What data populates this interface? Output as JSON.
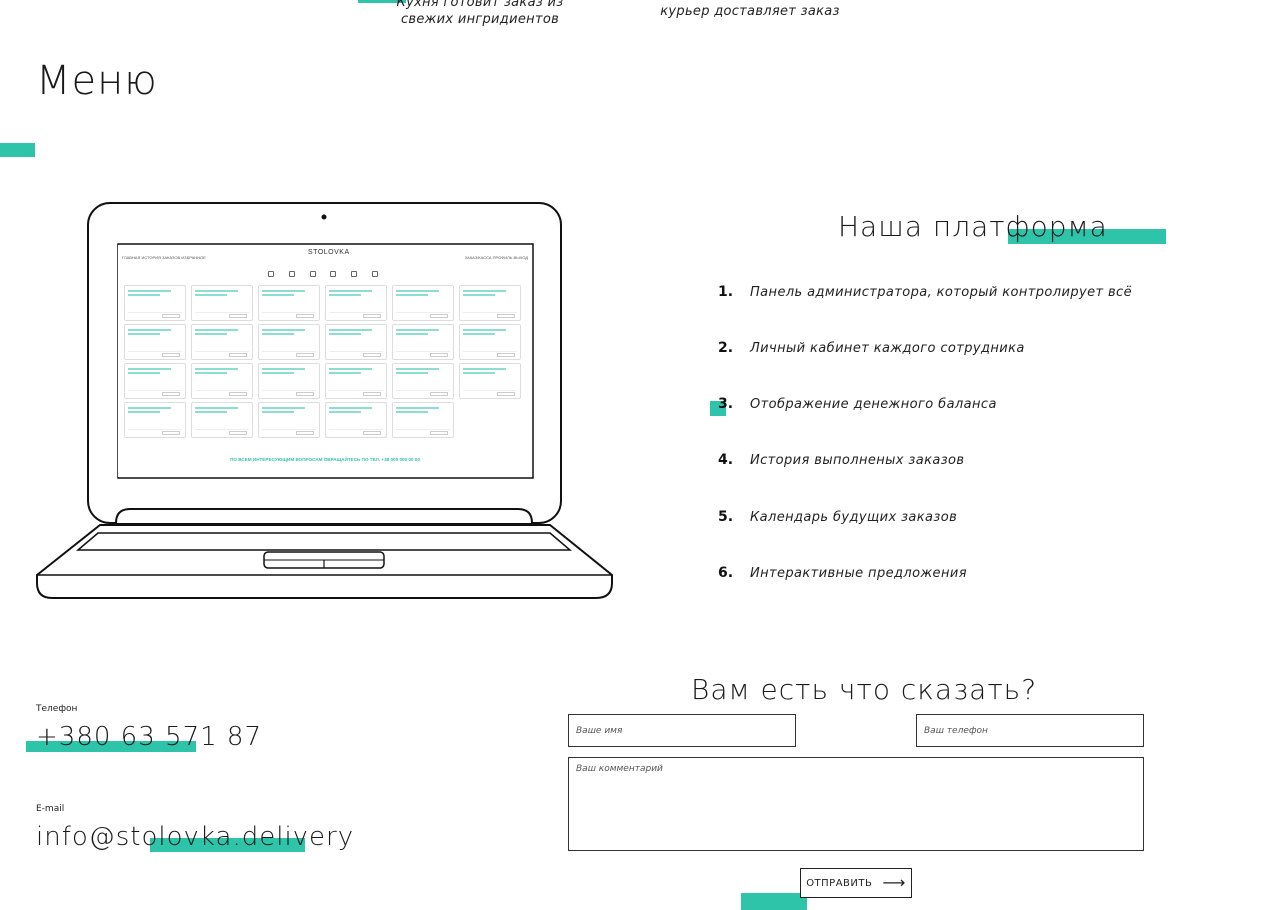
{
  "steps": {
    "kitchen": "Кухня готовит заказ из свежих ингридиентов",
    "courier": "курьер доставляет заказ"
  },
  "menu": {
    "title": "Меню"
  },
  "laptop_screen": {
    "nav_left": "ГЛАВНАЯ   ИСТОРИЯ ЗАКАЗОВ   ИЗБРАННОЕ",
    "nav_right": "ЗАКАЗ/КАССА   ПРОФИЛЬ   ВЫХОД",
    "logo": "STOLOVKA",
    "footer": "ПО ВСЕМ ИНТЕРЕСУЮЩИМ ВОПРОСАМ ОБРАЩАЙТЕСЬ ПО ТЕЛ. +38 000 000 00 00"
  },
  "platform": {
    "title": "Наша платформа",
    "items": [
      {
        "num": "1.",
        "text": "Панель администратора, который контролирует всё"
      },
      {
        "num": "2.",
        "text": "Личный кабинет каждого сотрудника"
      },
      {
        "num": "3.",
        "text": "Отображение денежного баланса"
      },
      {
        "num": "4.",
        "text": "История выполненых заказов"
      },
      {
        "num": "5.",
        "text": "Календарь будущих заказов"
      },
      {
        "num": "6.",
        "text": "Интерактивные предложения"
      }
    ]
  },
  "contacts": {
    "phone_label": "Телефон",
    "phone": "+380 63 571 87",
    "email_label": "E-mail",
    "email": "info@stolovka.delivery"
  },
  "feedback": {
    "title": "Вам есть что сказать?",
    "name_placeholder": "Ваше имя",
    "phone_placeholder": "Ваш телефон",
    "comment_placeholder": "Ваш комментарий",
    "submit_label": "ОТПРАВИТЬ"
  },
  "colors": {
    "accent": "#2ec4a9",
    "text": "#1a1a1a"
  }
}
